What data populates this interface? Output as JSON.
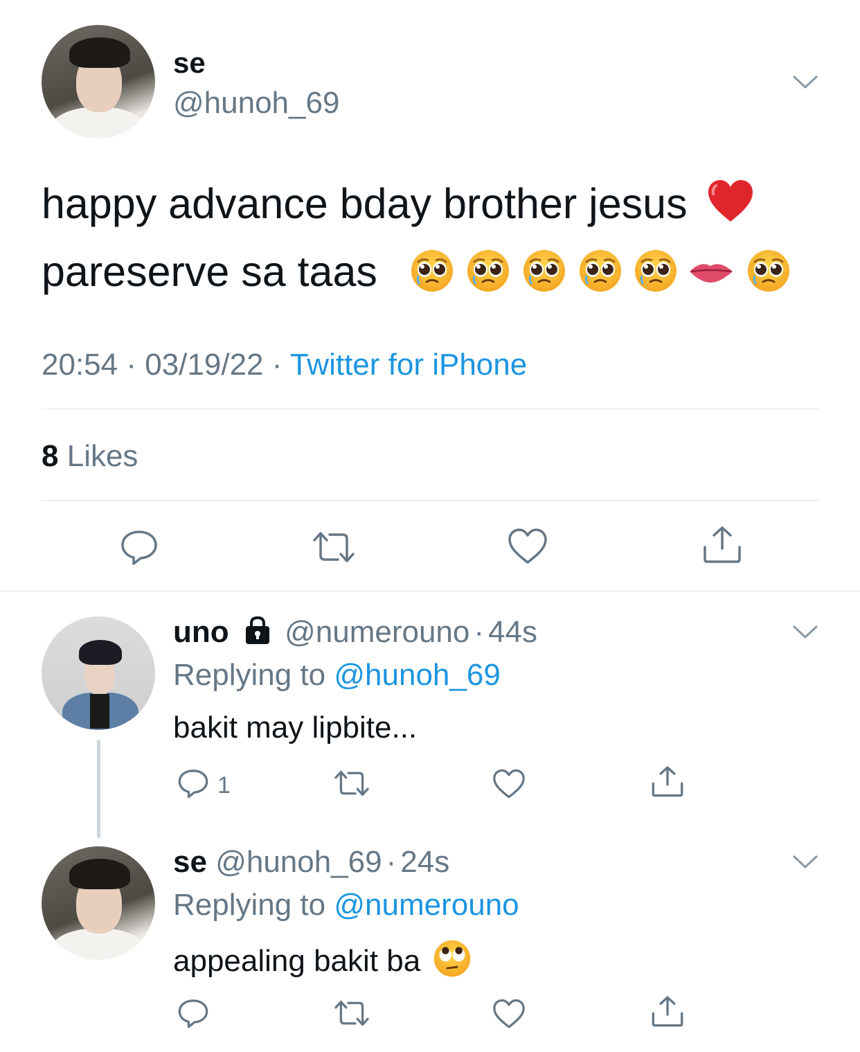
{
  "main_tweet": {
    "display_name": "se",
    "handle": "@hunoh_69",
    "text_line1": "happy advance bday brother jesus",
    "text_line2": "pareserve sa taas",
    "emoji_line1": [
      "red-heart"
    ],
    "emoji_line2": [
      "pleading-face",
      "pleading-face",
      "pleading-face",
      "pleading-face",
      "pleading-face",
      "lips",
      "pleading-face"
    ],
    "time": "20:54",
    "sep1": "·",
    "date": "03/19/22",
    "sep2": "·",
    "source": "Twitter for iPhone",
    "likes_count": "8",
    "likes_label": "Likes"
  },
  "replies": [
    {
      "display_name": "uno",
      "locked": true,
      "handle": "@numerouno",
      "sep": "·",
      "age": "44s",
      "replying_prefix": "Replying to",
      "replying_to": "@hunoh_69",
      "text": "bakit may lipbite...",
      "reply_count": "1"
    },
    {
      "display_name": "se",
      "handle": "@hunoh_69",
      "sep": "·",
      "age": "24s",
      "replying_prefix": "Replying to",
      "replying_to": "@numerouno",
      "text": "appealing bakit ba",
      "emoji": [
        "face-with-rolling-eyes"
      ]
    }
  ],
  "icons": {
    "reply": "reply-icon",
    "retweet": "retweet-icon",
    "like": "heart-icon",
    "share": "share-icon",
    "menu": "chevron-down-icon",
    "lock": "lock-icon"
  },
  "colors": {
    "text": "#0f1419",
    "muted": "#657786",
    "link": "#1b95e0",
    "divider": "#dfe4e8",
    "icon": "#657786"
  }
}
